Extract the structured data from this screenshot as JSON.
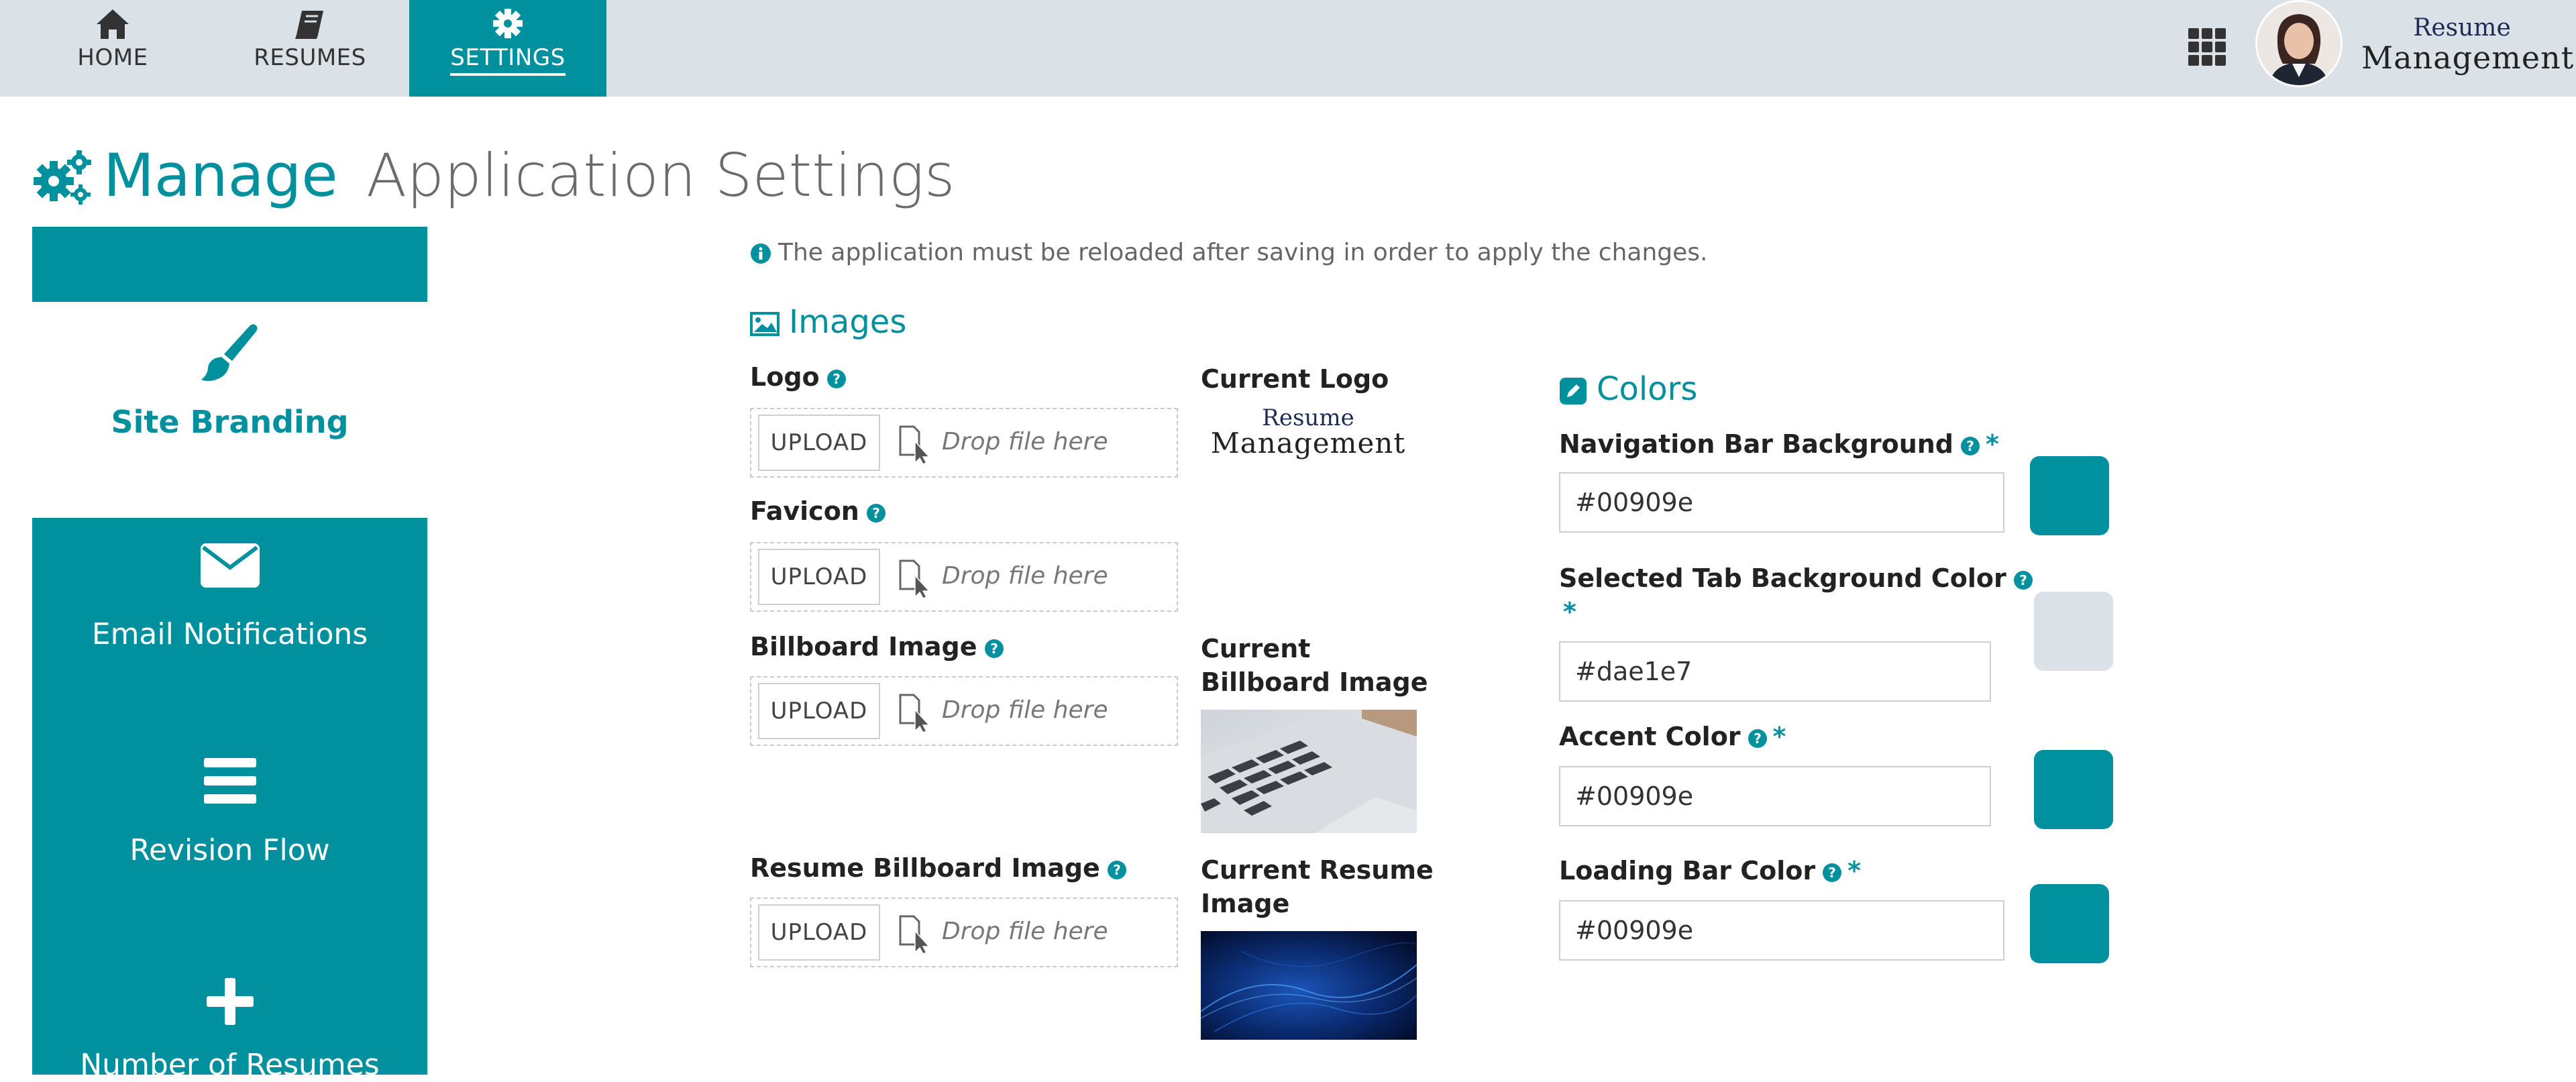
{
  "nav": {
    "items": [
      {
        "label": "HOME",
        "icon": "home-icon"
      },
      {
        "label": "RESUMES",
        "icon": "book-icon"
      },
      {
        "label": "SETTINGS",
        "icon": "gear-icon"
      }
    ],
    "brand": {
      "line1": "Resume",
      "line2": "Management"
    }
  },
  "page": {
    "title_accent": "Manage",
    "title_rest": "Application Settings"
  },
  "sidebar": {
    "items": [
      {
        "label": "Site Branding",
        "icon": "paintbrush-icon"
      },
      {
        "label": "Email Notifications",
        "icon": "envelope-icon"
      },
      {
        "label": "Revision Flow",
        "icon": "bars-icon"
      },
      {
        "label": "Number of Resumes",
        "icon": "plus-icon"
      }
    ]
  },
  "notice": "The application must be reloaded after saving in order to apply the changes.",
  "images": {
    "heading": "Images",
    "upload_label": "UPLOAD",
    "drop_placeholder": "Drop file here",
    "fields": [
      {
        "label": "Logo"
      },
      {
        "label": "Favicon"
      },
      {
        "label": "Billboard Image"
      },
      {
        "label": "Resume Billboard Image"
      }
    ],
    "current_logo_label": "Current Logo",
    "current_logo": {
      "line1": "Resume",
      "line2": "Management"
    },
    "current_billboard_label_1": "Current",
    "current_billboard_label_2": "Billboard Image",
    "current_resume_label_1": "Current Resume",
    "current_resume_label_2": "Image"
  },
  "colors": {
    "heading": "Colors",
    "required_mark": "*",
    "fields": [
      {
        "label": "Navigation Bar Background",
        "value": "#00909e"
      },
      {
        "label": "Selected Tab Background Color",
        "value": "#dae1e7"
      },
      {
        "label": "Accent Color",
        "value": "#00909e"
      },
      {
        "label": "Loading Bar Color",
        "value": "#00909e"
      }
    ]
  },
  "theme": {
    "accent": "#00909e",
    "nav_bg": "#dae1e7"
  }
}
